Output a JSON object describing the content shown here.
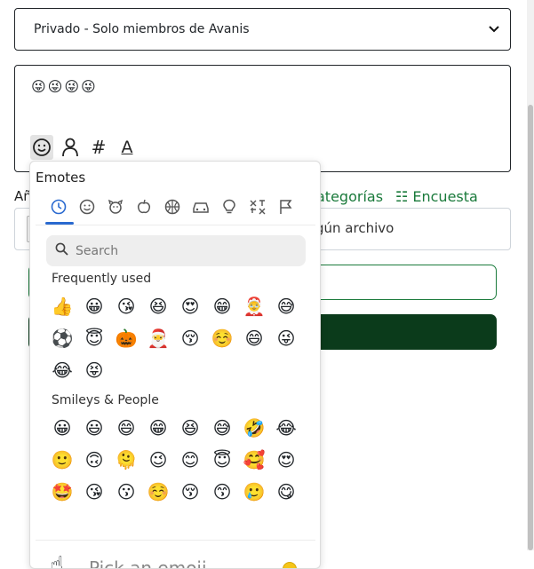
{
  "privacy_select": {
    "value": "Privado - Solo miembros de Avanis",
    "chevron_icon": "chevron-down-icon"
  },
  "editor": {
    "content": "😜😜😜😜",
    "toolbar": [
      {
        "name": "emoji-tool",
        "icon": "☺"
      },
      {
        "name": "mention-tool",
        "icon": "👤"
      },
      {
        "name": "hashtag-tool",
        "icon": "#"
      },
      {
        "name": "text-format-tool",
        "icon": "A"
      }
    ]
  },
  "background": {
    "left_label": "Añ",
    "links": [
      {
        "name": "categorias-link",
        "label": "ategorías",
        "icon": "tag-icon"
      },
      {
        "name": "encuesta-link",
        "label": "Encuesta",
        "icon": "☷"
      }
    ],
    "file_text": "gún archivo"
  },
  "picker": {
    "title": "Emotes",
    "categories": [
      {
        "name": "recent",
        "icon": "🕘"
      },
      {
        "name": "smileys",
        "icon": "☺"
      },
      {
        "name": "animals",
        "icon": "🐶"
      },
      {
        "name": "food",
        "icon": "🍎"
      },
      {
        "name": "activities",
        "icon": "🏀"
      },
      {
        "name": "travel",
        "icon": "🚗"
      },
      {
        "name": "objects",
        "icon": "💡"
      },
      {
        "name": "symbols",
        "icon": "🔣"
      },
      {
        "name": "flags",
        "icon": "🏳"
      }
    ],
    "search_placeholder": "Search",
    "sections": [
      {
        "label": "Frequently used",
        "emojis": [
          "👍",
          "😀",
          "😘",
          "😆",
          "😍",
          "😁",
          "🤶",
          "😅",
          "⚽",
          "😇",
          "🎃",
          "🎅",
          "😚",
          "☺️",
          "😄",
          "😜",
          "😂",
          "😝"
        ]
      },
      {
        "label": "Smileys & People",
        "emojis": [
          "😀",
          "😃",
          "😄",
          "😁",
          "😆",
          "😅",
          "🤣",
          "😂",
          "🙂",
          "🙃",
          "🫠",
          "😉",
          "😊",
          "😇",
          "🥰",
          "😍",
          "🤩",
          "😘",
          "😗",
          "☺️",
          "😚",
          "😙",
          "🥲",
          "😋"
        ]
      }
    ],
    "preview": {
      "icon": "☝",
      "placeholder": "Pick an emoji…"
    }
  }
}
